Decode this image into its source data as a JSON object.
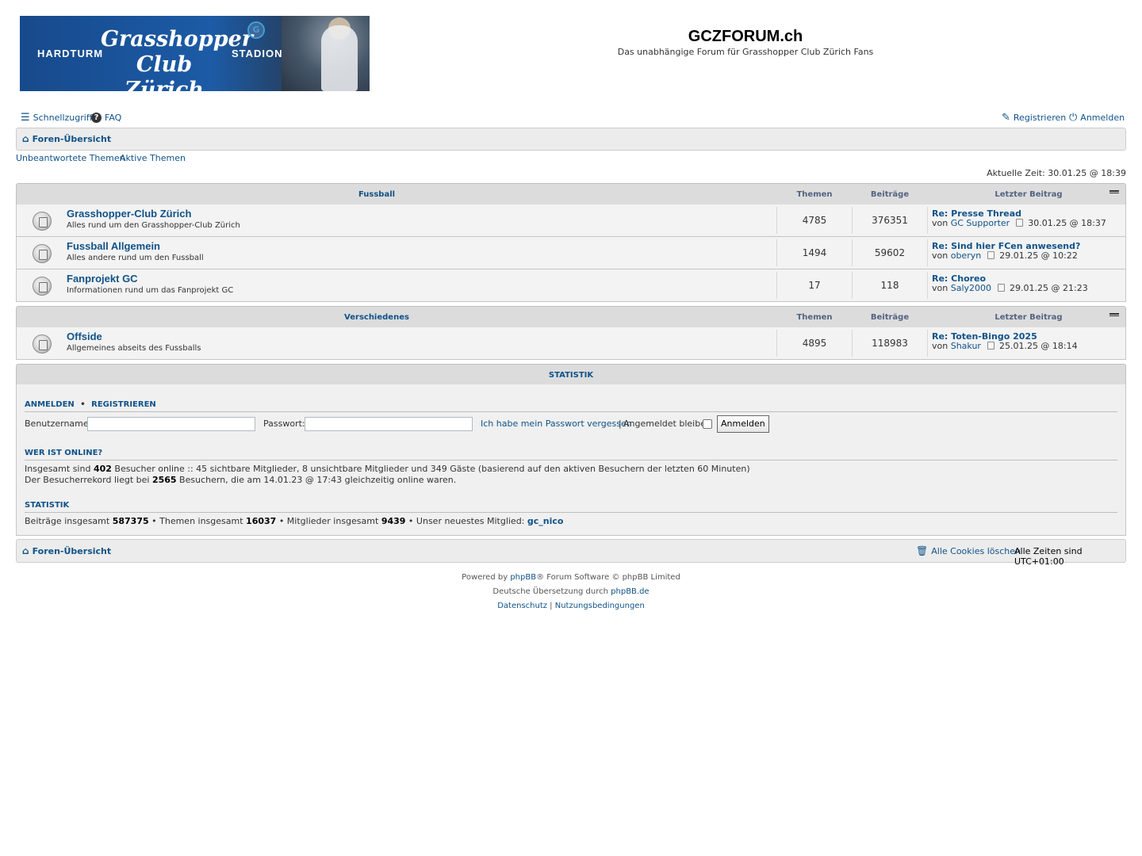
{
  "banner": {
    "left_text": "HARDTURM",
    "script_line1": "Grasshopper",
    "script_line2": "Club Zürich",
    "right_text": "STADION",
    "logo_text": "G"
  },
  "site": {
    "title": "GCZFORUM.ch",
    "description": "Das unabhängige Forum für Grasshopper Club Zürich Fans"
  },
  "nav": {
    "quicklinks": "Schnellzugriff",
    "faq": "FAQ",
    "register": "Registrieren",
    "login": "Anmelden"
  },
  "breadcrumb": {
    "home": "Foren-Übersicht"
  },
  "subnav": {
    "unanswered": "Unbeantwortete Themen",
    "active": "Aktive Themen",
    "current_time": "Aktuelle Zeit: 30.01.25 @ 18:39"
  },
  "table_headers": {
    "topics": "Themen",
    "posts": "Beiträge",
    "last_post": "Letzter Beitrag"
  },
  "categories": [
    {
      "name": "Fussball",
      "forums": [
        {
          "title": "Grasshopper-Club Zürich",
          "desc": "Alles rund um den Grasshopper-Club Zürich",
          "topics": "4785",
          "posts": "376351",
          "last_title": "Re: Presse Thread",
          "by_prefix": "von",
          "last_author": "GC Supporter",
          "last_time": "30.01.25 @ 18:37"
        },
        {
          "title": "Fussball Allgemein",
          "desc": "Alles andere rund um den Fussball",
          "topics": "1494",
          "posts": "59602",
          "last_title": "Re: Sind hier FCen anwesend?",
          "by_prefix": "von",
          "last_author": "oberyn",
          "last_time": "29.01.25 @ 10:22"
        },
        {
          "title": "Fanprojekt GC",
          "desc": "Informationen rund um das Fanprojekt GC",
          "topics": "17",
          "posts": "118",
          "last_title": "Re: Choreo",
          "by_prefix": "von",
          "last_author": "Saly2000",
          "last_time": "29.01.25 @ 21:23"
        }
      ]
    },
    {
      "name": "Verschiedenes",
      "forums": [
        {
          "title": "Offside",
          "desc": "Allgemeines abseits des Fussballs",
          "topics": "4895",
          "posts": "118983",
          "last_title": "Re: Toten-Bingo 2025",
          "by_prefix": "von",
          "last_author": "Shakur",
          "last_time": "25.01.25 @ 18:14"
        }
      ]
    }
  ],
  "stats": {
    "heading": "STATISTIK",
    "login_section": {
      "login": "ANMELDEN",
      "dot": "•",
      "register": "REGISTRIEREN"
    },
    "username_label": "Benutzername:",
    "password_label": "Passwort:",
    "forgot": "Ich habe mein Passwort vergessen",
    "pipe": "|",
    "remember": "Angemeldet bleiben",
    "login_button": "Anmelden",
    "online_title": "WER IST ONLINE?",
    "online": {
      "p1": "Insgesamt sind ",
      "n1": "402",
      "p2": " Besucher online :: 45 sichtbare Mitglieder, 8 unsichtbare Mitglieder und 349 Gäste (basierend auf den aktiven Besuchern der letzten 60 Minuten)"
    },
    "record": {
      "p1": "Der Besucherrekord liegt bei ",
      "n1": "2565",
      "p2": " Besuchern, die am 14.01.23 @ 17:43 gleichzeitig online waren."
    },
    "stats_title": "STATISTIK",
    "totals": {
      "p1": "Beiträge insgesamt ",
      "posts": "587375",
      "p2": " • Themen insgesamt ",
      "topics": "16037",
      "p3": " • Mitglieder insgesamt ",
      "members": "9439",
      "p4": " • Unser neuestes Mitglied: ",
      "newest": "gc_nico"
    }
  },
  "footer": {
    "home": "Foren-Übersicht",
    "cookies": "Alle Cookies löschen",
    "timezone": "Alle Zeiten sind UTC+01:00",
    "powered_prefix": "Powered by ",
    "phpbb": "phpBB",
    "powered_suffix": "® Forum Software © phpBB Limited",
    "translation_prefix": "Deutsche Übersetzung durch ",
    "phpbb_de": "phpBB.de",
    "privacy": "Datenschutz",
    "sep": " | ",
    "terms": "Nutzungsbedingungen"
  },
  "colors": {
    "link": "#105289",
    "header_bg": "#dcdcdc",
    "row_bg": "#f3f3f3",
    "banner_blue": "#1c5ba6"
  }
}
